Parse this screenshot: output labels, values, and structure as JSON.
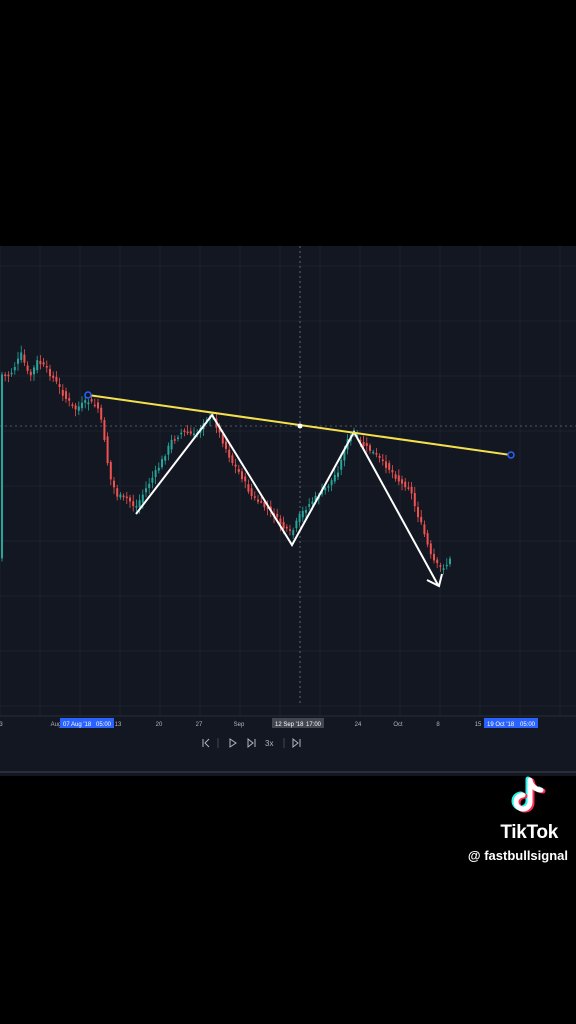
{
  "chart_data": {
    "type": "candlestick",
    "x_axis_ticks": [
      "3",
      "Aug",
      "13",
      "20",
      "27",
      "Sep",
      "24",
      "Oct",
      "8",
      "15"
    ],
    "x_axis_highlights": [
      {
        "date": "07 Aug '18",
        "time": "05:00"
      },
      {
        "date": "12 Sep '18",
        "time": "17:00"
      },
      {
        "date": "19 Oct '18",
        "time": "05:00"
      }
    ],
    "pattern": "triple-bottom (inverse head and shoulders) with descending neckline",
    "colors": {
      "background": "#131722",
      "up_candle": "#26a69a",
      "down_candle": "#ef5350",
      "trendline": "#f4e04d",
      "zigzag": "#ffffff",
      "axis_highlight": "#2962ff"
    }
  },
  "replay_controls": {
    "speed_label": "3x",
    "icons": [
      "jump-to-start-icon",
      "play-icon",
      "step-forward-icon",
      "jump-to-real-time-icon"
    ]
  },
  "watermark": {
    "brand": "TikTok",
    "handle": "@ fastbullsignal"
  }
}
